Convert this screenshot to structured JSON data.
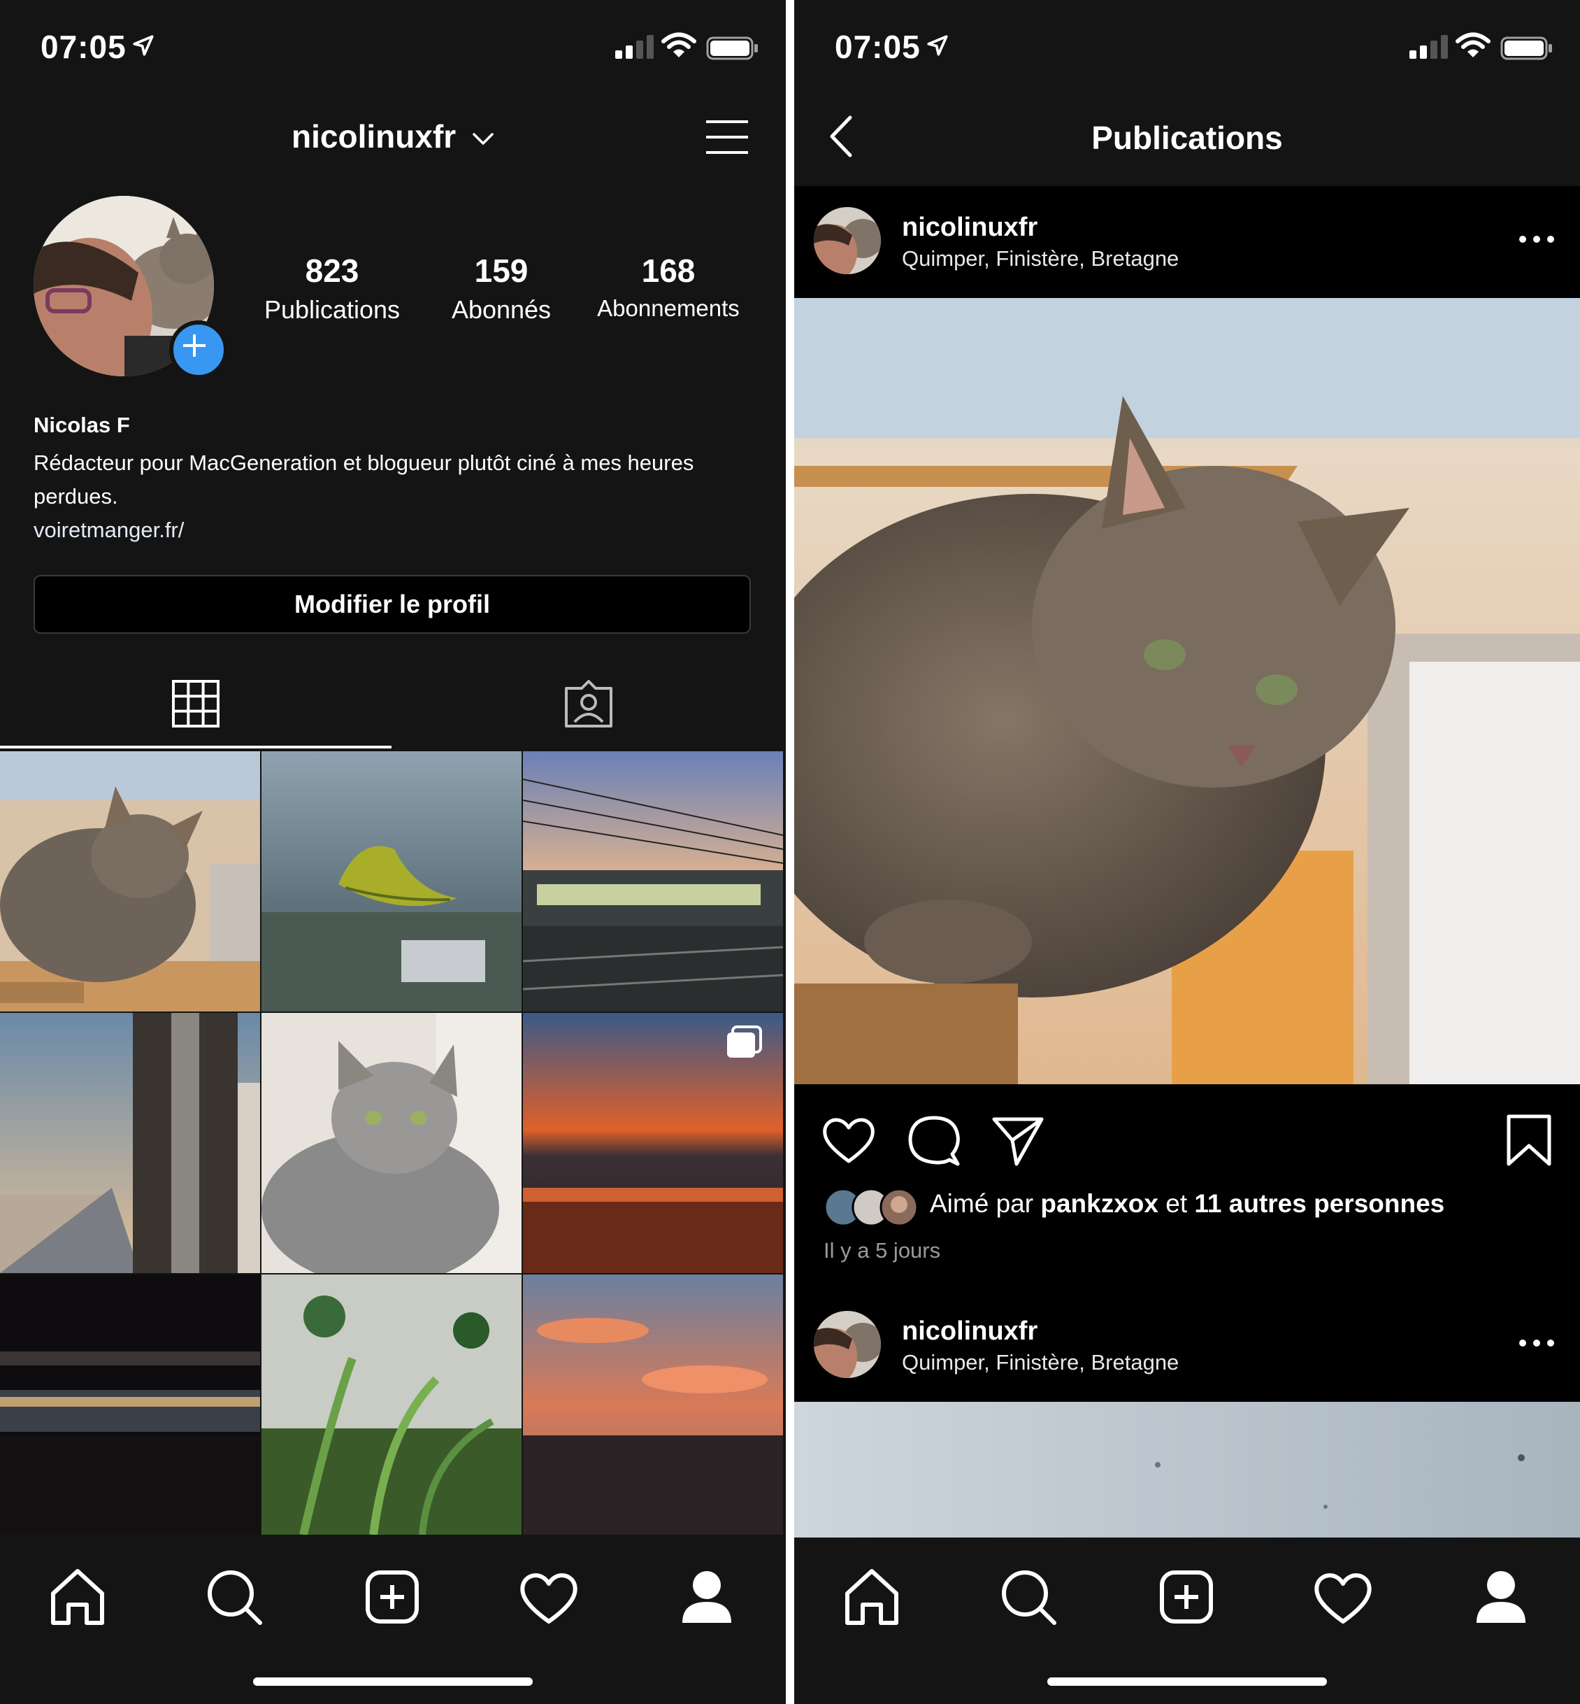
{
  "status": {
    "time": "07:05"
  },
  "profile": {
    "username": "nicolinuxfr",
    "stats": [
      {
        "value": "823",
        "label": "Publications"
      },
      {
        "value": "159",
        "label": "Abonnés"
      },
      {
        "value": "168",
        "label": "Abonnements"
      }
    ],
    "name": "Nicolas F",
    "bio": "Rédacteur pour MacGeneration et blogueur plutôt ciné à mes heures perdues.",
    "link": "voiretmanger.fr/",
    "edit_label": "Modifier le profil"
  },
  "feed": {
    "title": "Publications",
    "posts": [
      {
        "user": "nicolinuxfr",
        "location": "Quimper, Finistère, Bretagne"
      },
      {
        "user": "nicolinuxfr",
        "location": "Quimper, Finistère, Bretagne"
      }
    ],
    "liked_prefix": "Aimé par",
    "liked_user": "pankzxox",
    "liked_mid": "et",
    "liked_others": "11 autres personnes",
    "time_ago": "Il y a 5 jours"
  },
  "icons": [
    "location-arrow-icon",
    "signal-icon",
    "wifi-icon",
    "battery-icon",
    "chevron-down-icon",
    "menu-icon",
    "plus-icon",
    "grid-icon",
    "tagged-icon",
    "home-icon",
    "search-icon",
    "add-icon",
    "heart-icon",
    "profile-icon",
    "back-icon",
    "more-icon",
    "comment-icon",
    "share-icon",
    "bookmark-icon",
    "carousel-icon"
  ],
  "colors": {
    "background": "#141414",
    "accent": "#3897f0"
  }
}
